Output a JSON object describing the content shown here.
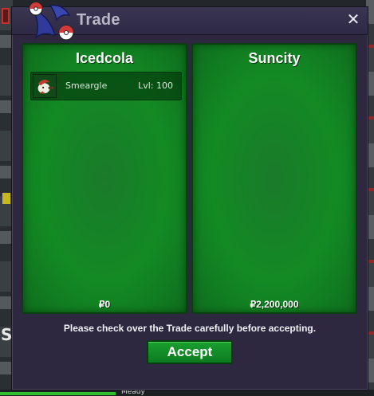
{
  "window": {
    "title": "Trade",
    "close_glyph": "✕"
  },
  "left_panel": {
    "player": "Icedcola",
    "items": [
      {
        "name": "Smeargle",
        "level": "Lvl: 100",
        "icon": "smeargle-sprite"
      }
    ],
    "money": "₽0"
  },
  "right_panel": {
    "player": "Suncity",
    "money": "₽2,200,000"
  },
  "notice": "Please check over the Trade carefully before accepting.",
  "accept_label": "Accept",
  "background": {
    "side_letter": "S",
    "bottom_label": "Meady"
  },
  "colors": {
    "panel_green": "#138a24",
    "window_bg": "#2d2840",
    "accent_red": "#d33a3a"
  }
}
